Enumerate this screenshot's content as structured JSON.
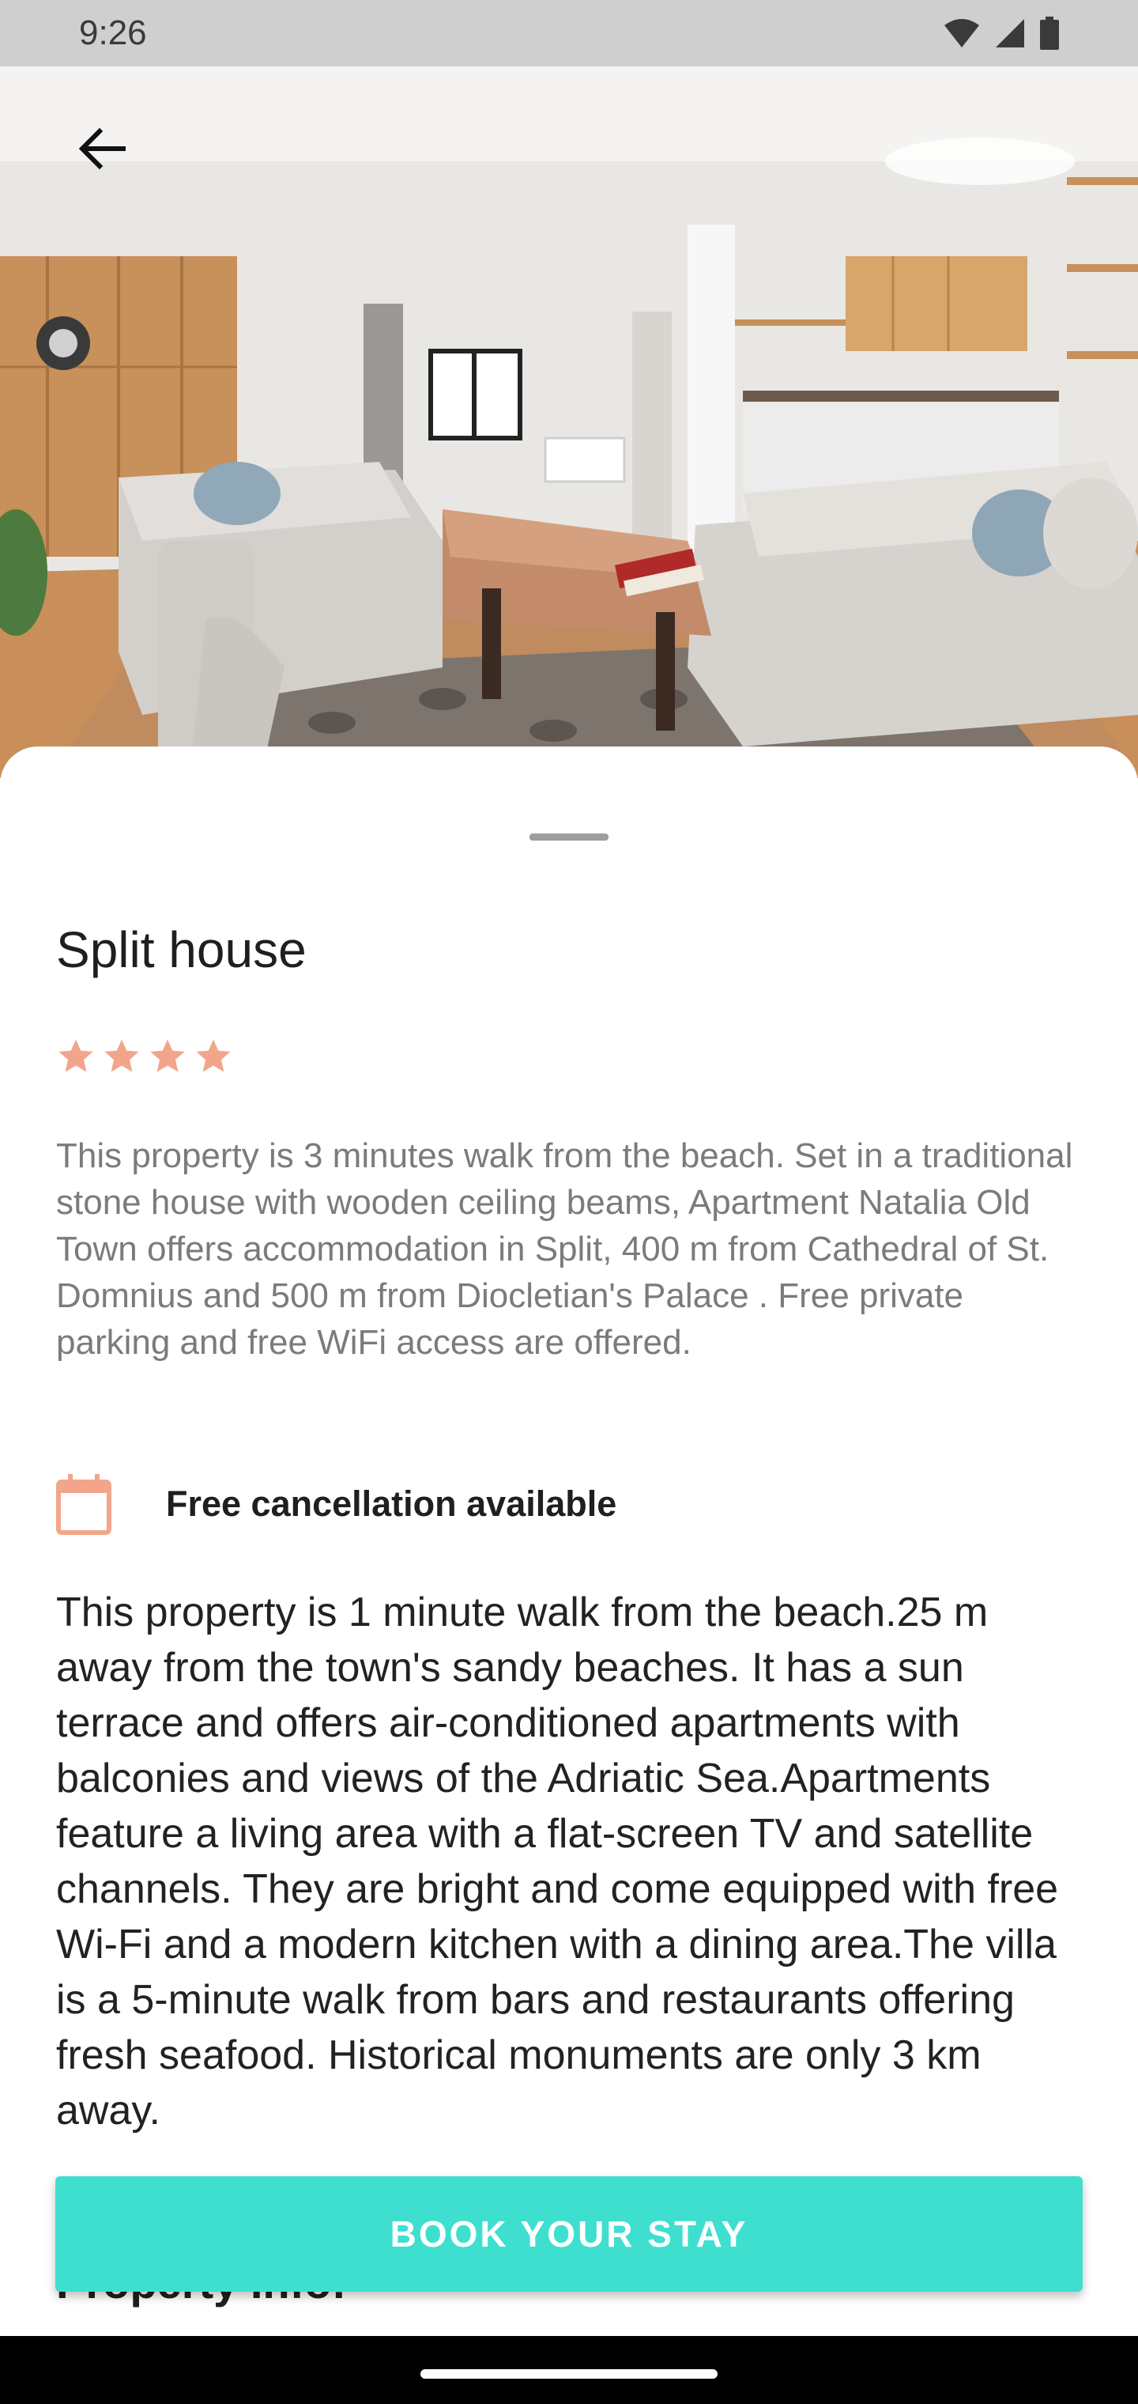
{
  "status_bar": {
    "time": "9:26",
    "icons": [
      "wifi-icon",
      "signal-icon",
      "battery-icon"
    ]
  },
  "header": {
    "back_icon": "arrow-left-icon"
  },
  "property": {
    "title": "Split house",
    "rating": 4,
    "rating_max": 4,
    "star_color": "#f3a58b",
    "short_description": "This property is 3 minutes walk from the beach. Set in a traditional stone house with wooden ceiling beams, Apartment Natalia Old Town offers accommodation in Split, 400 m from Cathedral of St. Domnius and 500 m from Diocletian's Palace . Free private parking and free WiFi access are offered.",
    "cancellation": {
      "icon": "calendar-icon",
      "icon_color": "#f3a58b",
      "label": "Free cancellation available"
    },
    "long_description": "This property is 1 minute walk from the beach.25 m away from the town's sandy beaches. It has a sun terrace and offers air-conditioned apartments with balconies and views of the Adriatic Sea.Apartments feature a living area with a flat-screen TV and satellite channels. They are bright and come equipped with free Wi-Fi and a modern kitchen with a dining area.The villa is a 5-minute walk from bars and restaurants offering fresh seafood. Historical monuments are only 3 km away.",
    "section_heading": "Property Info:"
  },
  "actions": {
    "book_label": "BOOK YOUR STAY",
    "book_color": "#3fdfd0"
  }
}
